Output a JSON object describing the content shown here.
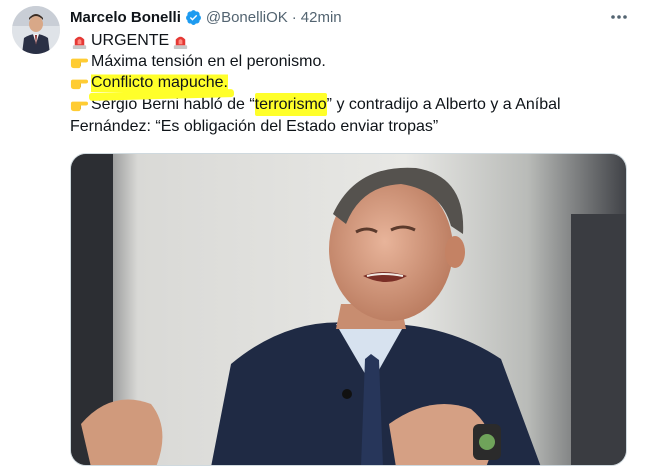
{
  "tweet": {
    "author_name": "Marcelo Bonelli",
    "handle": "@BonelliOK",
    "separator": "·",
    "time": "42min",
    "line1": "URGENTE",
    "line2": "Máxima tensión en el peronismo.",
    "line3": "Conflicto mapuche.",
    "line4_pre": "Sergio Berni habló de “",
    "line4_term": "terrorismo",
    "line4_post": "” y contradijo a Alberto y a Aníbal",
    "line5": "Fernández: “Es obligación del Estado enviar tropas”"
  },
  "icons": {
    "verified": "verified-badge-icon",
    "more": "more-options-icon",
    "siren": "police-light-icon",
    "pointing": "backhand-index-pointing-right-icon"
  },
  "colors": {
    "highlight": "#ffff2a",
    "verified": "#1d9bf0",
    "text": "#0f1419",
    "secondary": "#536471"
  }
}
